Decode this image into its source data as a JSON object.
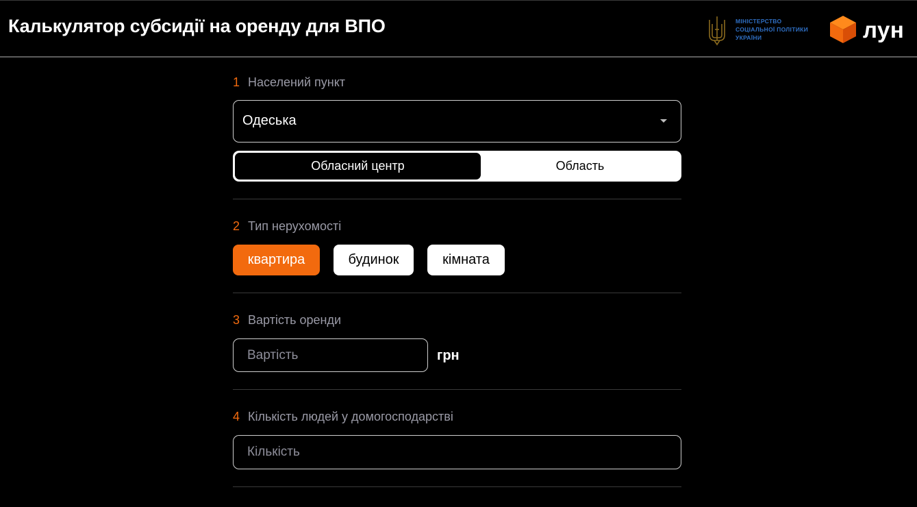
{
  "header": {
    "title": "Калькулятор субсидії на оренду для ВПО",
    "ministry": {
      "icon": "trident-icon",
      "lines": [
        "МІНІСТЕРСТВО",
        "СОЦІАЛЬНОЇ ПОЛІТИКИ",
        "УКРАЇНИ"
      ],
      "color": "#2f6fc4"
    },
    "lun": {
      "icon": "lun-cube-icon",
      "text": "лун",
      "color": "#f26a0e"
    }
  },
  "accent_color": "#f26a0e",
  "sections": {
    "location": {
      "number": "1",
      "label": "Населений пункт",
      "selected_region": "Одеська",
      "toggle": {
        "selected": "Обласний центр",
        "other": "Область"
      }
    },
    "property_type": {
      "number": "2",
      "label": "Тип нерухомості",
      "options": [
        "квартира",
        "будинок",
        "кімната"
      ],
      "selected": "квартира"
    },
    "rent_cost": {
      "number": "3",
      "label": "Вартість оренди",
      "placeholder": "Вартість",
      "value": "",
      "unit": "грн"
    },
    "household": {
      "number": "4",
      "label": "Кількість людей у домогосподарстві",
      "placeholder": "Кількість",
      "value": ""
    }
  }
}
